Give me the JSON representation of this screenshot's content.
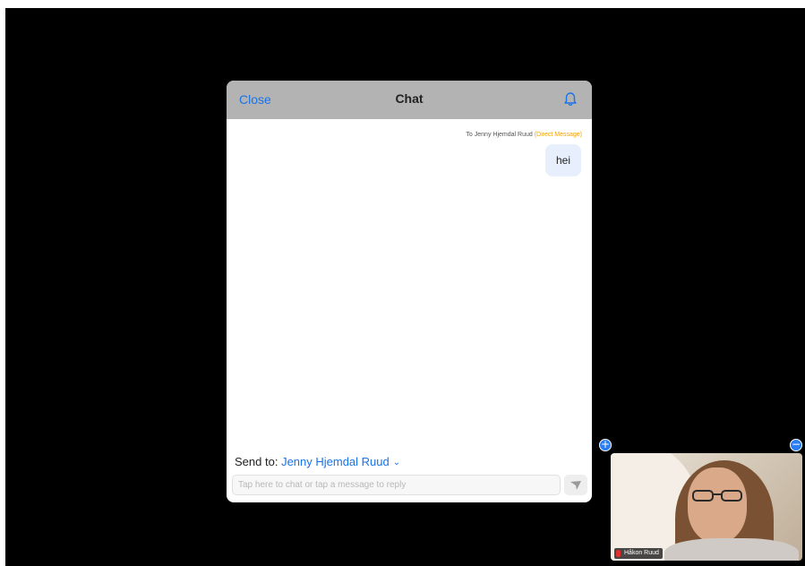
{
  "chat": {
    "close_label": "Close",
    "title": "Chat",
    "bell_icon": "bell-icon",
    "message": {
      "to_prefix": "To",
      "recipient": "Jenny Hjemdal Ruud",
      "dm_label": "(Direct Message)",
      "text": "hei"
    },
    "send_to_label": "Send to:",
    "send_to_target": "Jenny Hjemdal Ruud",
    "input_placeholder": "Tap here to chat or tap a message to reply",
    "send_icon": "send-icon"
  },
  "video": {
    "participant_name": "Håkon Ruud",
    "mic_status": "muted",
    "expand_icon": "plus-icon",
    "collapse_icon": "minus-icon"
  },
  "colors": {
    "accent": "#1a73e8",
    "dm_highlight": "#f2a000",
    "header_bg": "#b3b3b3",
    "bubble_bg": "#e6effb",
    "background": "#000000"
  }
}
